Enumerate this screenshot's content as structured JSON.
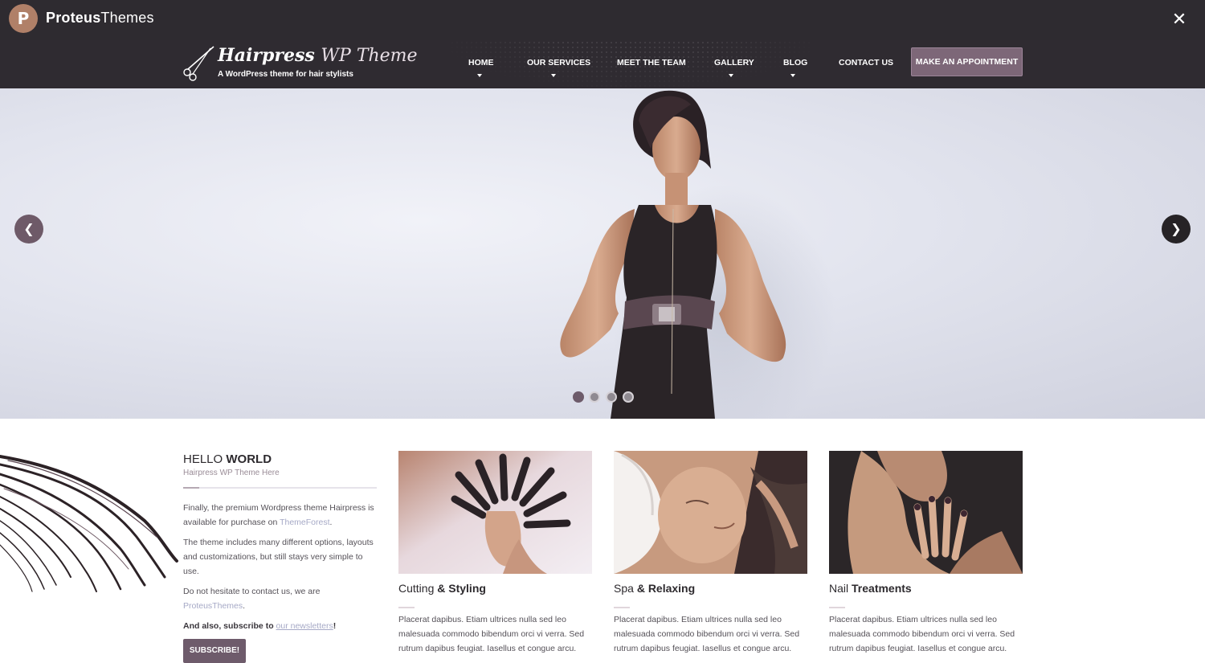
{
  "demo_bar": {
    "logo_letter": "P",
    "brand_bold": "Proteus",
    "brand_light": "Themes",
    "close_icon": "close-icon"
  },
  "header": {
    "title_bold": "Hairpress",
    "title_light": "WP Theme",
    "tagline": "A WordPress theme for hair stylists",
    "logo_icon": "scissors-icon",
    "nav": [
      {
        "label": "HOME",
        "has_dropdown": true
      },
      {
        "label": "OUR SERVICES",
        "has_dropdown": true
      },
      {
        "label": "MEET THE TEAM",
        "has_dropdown": false
      },
      {
        "label": "GALLERY",
        "has_dropdown": true
      },
      {
        "label": "BLOG",
        "has_dropdown": true
      },
      {
        "label": "CONTACT US",
        "has_dropdown": false
      }
    ],
    "cta": "MAKE AN APPOINTMENT"
  },
  "slider": {
    "prev_icon": "chevron-left-icon",
    "next_icon": "chevron-right-icon",
    "prev_glyph": "❮",
    "next_glyph": "❯",
    "slide_count": 4,
    "active_slide": 1
  },
  "intro": {
    "title_light": "HELLO",
    "title_bold": "WORLD",
    "subtitle": "Hairpress WP Theme Here",
    "p1_before": "Finally, the premium Wordpress theme Hairpress is available for purchase on",
    "p1_link": "ThemeForest",
    "p1_after": ".",
    "p2": "The theme includes many different options, layouts and customizations, but still stays very simple to use.",
    "p3_before": "Do not hesitate to contact us, we are",
    "p3_link": "ProteusThemes",
    "p3_after": ".",
    "p4_before": "And also, subscribe to",
    "p4_link": "our newsletters",
    "p4_after": "!",
    "subscribe": "SUBSCRIBE!"
  },
  "services": [
    {
      "title_light": "Cutting",
      "title_bold": "& Styling",
      "text": "Placerat dapibus. Etiam ultrices nulla sed leo malesuada commodo bibendum orci vi verra. Sed rutrum dapibus feugiat. Iasellus et congue arcu."
    },
    {
      "title_light": "Spa",
      "title_bold": "& Relaxing",
      "text": "Placerat dapibus. Etiam ultrices nulla sed leo malesuada commodo bibendum orci vi verra. Sed rutrum dapibus feugiat. Iasellus et congue arcu."
    },
    {
      "title_light": "Nail",
      "title_bold": "Treatments",
      "text": "Placerat dapibus. Etiam ultrices nulla sed leo malesuada commodo bibendum orci vi verra. Sed rutrum dapibus feugiat. Iasellus et congue arcu."
    }
  ],
  "colors": {
    "topbar": "#2e2b30",
    "header": "#2f2b31",
    "accent": "#7d6778",
    "link": "#a6a9c6",
    "logo_badge": "#b08068"
  }
}
